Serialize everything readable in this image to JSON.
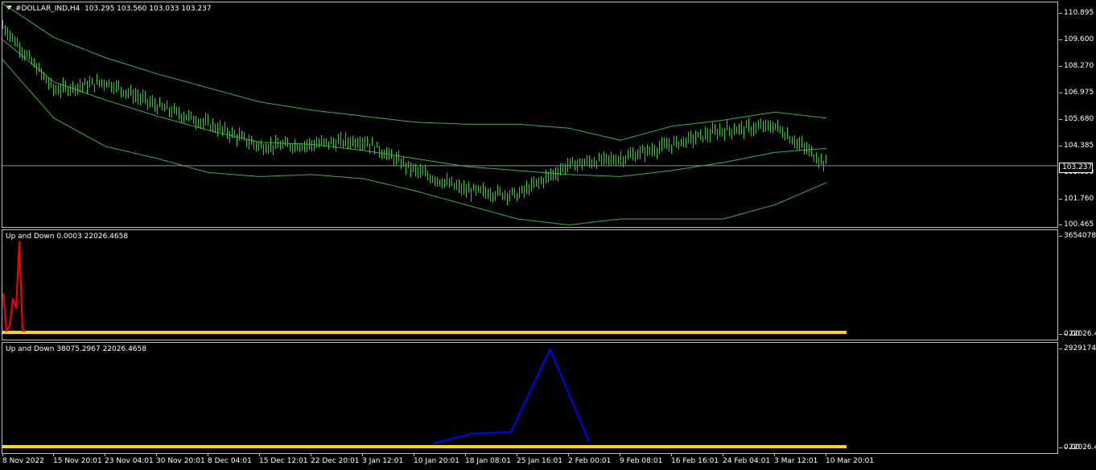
{
  "main_pane": {
    "title": "#DOLLAR_IND,H4  103.295 103.560 103.033 103.237",
    "current_price": "103.237",
    "y_ticks": [
      "110.895",
      "109.600",
      "108.270",
      "106.975",
      "105.680",
      "104.385",
      "103.090",
      "101.760",
      "100.465"
    ]
  },
  "indicator1": {
    "title": "Up and Down 0.0003 22026.4658",
    "y_ticks": [
      "3654078.8",
      "0.00",
      "22026.47"
    ]
  },
  "indicator2": {
    "title": "Up and Down 38075.2967 22026.4658",
    "y_ticks": [
      "29291746.",
      "0.00",
      "22026.47"
    ]
  },
  "x_ticks": [
    "8 Nov 2022",
    "15 Nov 20:01",
    "23 Nov 04:01",
    "30 Nov 20:01",
    "8 Dec 04:01",
    "15 Dec 12:01",
    "22 Dec 20:01",
    "3 Jan 12:01",
    "10 Jan 20:01",
    "18 Jan 08:01",
    "25 Jan 16:01",
    "2 Feb 00:01",
    "9 Feb 08:01",
    "16 Feb 16:01",
    "24 Feb 04:01",
    "3 Mar 12:01",
    "10 Mar 20:01"
  ],
  "colors": {
    "background": "#000000",
    "bars": "#32cd32",
    "bands": "#3cb043",
    "indicator1_line": "#ff0000",
    "indicator2_line": "#0000ff",
    "zero_line": "#ffd700",
    "grid_border": "#bfbfbf"
  },
  "chart_data": [
    {
      "type": "line",
      "name": "main",
      "description": "H4 bars with envelope bands",
      "ylim": [
        100.2,
        111.3
      ],
      "x": [
        "8 Nov 2022",
        "15 Nov 20:01",
        "23 Nov 04:01",
        "30 Nov 20:01",
        "8 Dec 04:01",
        "15 Dec 12:01",
        "22 Dec 20:01",
        "3 Jan 12:01",
        "10 Jan 20:01",
        "18 Jan 08:01",
        "25 Jan 16:01",
        "2 Feb 00:01",
        "9 Feb 08:01",
        "16 Feb 16:01",
        "24 Feb 04:01",
        "3 Mar 12:01",
        "10 Mar 20:01"
      ],
      "series": [
        {
          "values": [
            110.2,
            107.0,
            107.4,
            106.2,
            105.3,
            104.2,
            104.3,
            104.5,
            103.0,
            102.0,
            101.8,
            103.3,
            103.6,
            104.3,
            105.0,
            105.2,
            103.3
          ]
        },
        {
          "values": [
            111.3,
            109.6,
            108.6,
            107.8,
            107.1,
            106.4,
            106.0,
            105.7,
            105.4,
            105.3,
            105.3,
            105.1,
            104.5,
            105.2,
            105.5,
            105.9,
            105.6
          ]
        },
        {
          "values": [
            109.5,
            107.4,
            106.5,
            105.7,
            105.0,
            104.4,
            104.3,
            104.0,
            103.6,
            103.2,
            103.0,
            102.8,
            102.7,
            103.0,
            103.4,
            103.9,
            104.1
          ]
        },
        {
          "values": [
            108.5,
            105.6,
            104.2,
            103.6,
            102.9,
            102.7,
            102.8,
            102.6,
            102.0,
            101.3,
            100.6,
            100.3,
            100.6,
            100.6,
            100.6,
            101.3,
            102.4
          ]
        }
      ]
    },
    {
      "type": "line",
      "name": "indicator1",
      "ylim": [
        0,
        3654078.8
      ],
      "x": [
        "8 Nov 2022",
        "9 Nov",
        "10 Nov",
        "11 Nov",
        "12 Nov",
        "13 Nov",
        "14 Nov",
        "15 Nov 20:01"
      ],
      "series": [
        {
          "values": [
            1500000,
            0,
            200000,
            1300000,
            900000,
            3600000,
            0,
            0
          ]
        }
      ]
    },
    {
      "type": "line",
      "name": "indicator2",
      "ylim": [
        0,
        29291746
      ],
      "x": [
        "10 Jan 20:01",
        "18 Jan 08:01",
        "25 Jan 16:01",
        "2 Feb 00:01",
        "9 Feb 08:01"
      ],
      "series": [
        {
          "values": [
            500000,
            3500000,
            4000000,
            29000000,
            1000000
          ]
        }
      ]
    }
  ]
}
